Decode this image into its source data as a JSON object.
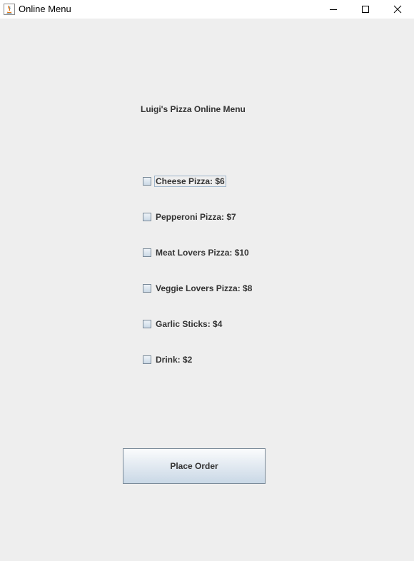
{
  "window": {
    "title": "Online Menu",
    "controls": [
      "minimize-icon",
      "maximize-icon",
      "close-icon"
    ]
  },
  "menu": {
    "title": "Luigi's Pizza Online Menu",
    "items": [
      {
        "label": "Cheese Pizza: $6",
        "checked": false
      },
      {
        "label": "Pepperoni Pizza: $7",
        "checked": false
      },
      {
        "label": "Meat Lovers Pizza: $10",
        "checked": false
      },
      {
        "label": "Veggie Lovers Pizza: $8",
        "checked": false
      },
      {
        "label": "Garlic Sticks: $4",
        "checked": false
      },
      {
        "label": "Drink: $2",
        "checked": false
      }
    ]
  },
  "actions": {
    "place_order_label": "Place Order"
  },
  "colors": {
    "background": "#eeeeee",
    "text": "#333333",
    "button_border": "#7a8a99"
  }
}
